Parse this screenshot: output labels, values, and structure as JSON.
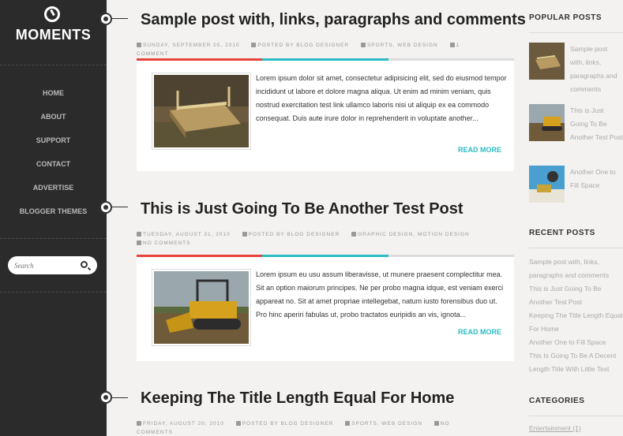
{
  "site": {
    "title": "MOMENTS"
  },
  "nav": {
    "items": [
      {
        "label": "HOME"
      },
      {
        "label": "ABOUT"
      },
      {
        "label": "SUPPORT"
      },
      {
        "label": "CONTACT"
      },
      {
        "label": "ADVERTISE"
      },
      {
        "label": "BLOGGER THEMES"
      }
    ]
  },
  "search": {
    "placeholder": "Search"
  },
  "posts": [
    {
      "title": "Sample post with, links, paragraphs and comments",
      "date": "SUNDAY, SEPTEMBER 05, 2010",
      "author": "POSTED BY BLOG DESIGNER",
      "labels": "SPORTS, WEB DESIGN",
      "comments": "1 COMMENT",
      "excerpt": "Lorem ipsum dolor sit amet, consectetur adipisicing elit, sed do eiusmod tempor incididunt ut labore et dolore magna aliqua. Ut enim ad minim veniam, quis nostrud exercitation test link ullamco laboris nisi ut aliquip ex ea commodo consequat. Duis aute irure dolor in reprehenderit in voluptate another...",
      "read_more": "READ MORE"
    },
    {
      "title": "This is Just Going To Be Another Test Post",
      "date": "TUESDAY, AUGUST 31, 2010",
      "author": "POSTED BY BLOG DESIGNER",
      "labels": "GRAPHIC DESIGN, MOTION DESIGN",
      "comments": "NO COMMENTS",
      "excerpt": "Lorem ipsum eu usu assum liberavisse, ut munere praesent complectitur mea. Sit an option maiorum principes. Ne per probo magna idque, est veniam exerci appareat no. Sit at amet propriae intellegebat, natum iusto forensibus duo ut. Pro hinc aperiri fabulas ut, probo tractatos euripidis an vis, ignota...",
      "read_more": "READ MORE"
    },
    {
      "title": "Keeping The Title Length Equal For Home",
      "date": "FRIDAY, AUGUST 20, 2010",
      "author": "POSTED BY BLOG DESIGNER",
      "labels": "SPORTS, WEB DESIGN",
      "comments": "NO COMMENTS"
    }
  ],
  "sidebar": {
    "popular_title": "POPULAR POSTS",
    "popular": [
      {
        "title": "Sample post with, links, paragraphs and comments"
      },
      {
        "title": "This is Just Going To Be Another Test Post"
      },
      {
        "title": "Another One to Fill Space"
      }
    ],
    "recent_title": "RECENT POSTS",
    "recent": [
      {
        "title": "Sample post with, links, paragraphs and comments"
      },
      {
        "title": "This is Just Going To Be Another Test Post"
      },
      {
        "title": "Keeping The Title Length Equal For Home"
      },
      {
        "title": "Another One to Fill Space"
      },
      {
        "title": "This Is Going To Be A Decent Length Title With Little Text"
      }
    ],
    "categories_title": "CATEGORIES",
    "categories": [
      {
        "label": "Entertainment (1)"
      }
    ]
  },
  "colors": {
    "accent_red": "#e8423c",
    "accent_teal": "#2bbcc5",
    "bar_gray": "#dcdcdc",
    "sidebar_bg": "#2b2b2b"
  }
}
